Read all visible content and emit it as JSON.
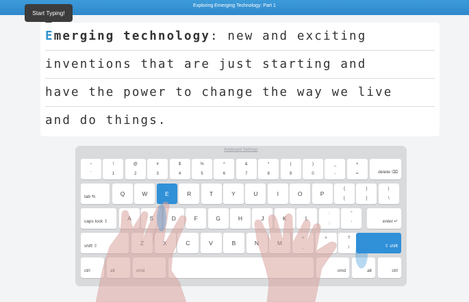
{
  "header": {
    "title": "Exploring Emerging Technology: Part 1"
  },
  "tooltip": {
    "text": "Start Typing!"
  },
  "passage": {
    "line1": {
      "cursor_letter": "E",
      "bold_rest": "merging technology",
      "rest": ": new and exciting"
    },
    "line2": "inventions that are just starting and",
    "line3": "have the power to change the way we live",
    "line4": "and do things."
  },
  "keyboard": {
    "settings_label": "Keyboard Settings",
    "row1": [
      {
        "top": "~",
        "bottom": "`"
      },
      {
        "top": "!",
        "bottom": "1"
      },
      {
        "top": "@",
        "bottom": "2"
      },
      {
        "top": "#",
        "bottom": "3"
      },
      {
        "top": "$",
        "bottom": "4"
      },
      {
        "top": "%",
        "bottom": "5"
      },
      {
        "top": "^",
        "bottom": "6"
      },
      {
        "top": "&",
        "bottom": "7"
      },
      {
        "top": "*",
        "bottom": "8"
      },
      {
        "top": "(",
        "bottom": "9"
      },
      {
        "top": ")",
        "bottom": "0"
      },
      {
        "top": "_",
        "bottom": "-"
      },
      {
        "top": "+",
        "bottom": "="
      }
    ],
    "delete_label": "delete ⌫",
    "tab_label": "tab ⇆",
    "row2_letters": [
      "Q",
      "W",
      "E",
      "R",
      "T",
      "Y",
      "U",
      "I",
      "O",
      "P"
    ],
    "row2_symbols": [
      {
        "top": "{",
        "bottom": "["
      },
      {
        "top": "}",
        "bottom": "]"
      },
      {
        "top": "|",
        "bottom": "\\"
      }
    ],
    "caps_label": "caps lock ⇪",
    "row3_letters": [
      "A",
      "S",
      "D",
      "F",
      "G",
      "H",
      "J",
      "K",
      "L"
    ],
    "row3_symbols": [
      {
        "top": ":",
        "bottom": ";"
      },
      {
        "top": "\"",
        "bottom": "'"
      }
    ],
    "enter_label": "enter ↵",
    "shift_left_label": "shift ⇧",
    "row4_letters": [
      "Z",
      "X",
      "C",
      "V",
      "B",
      "N",
      "M"
    ],
    "row4_symbols": [
      {
        "top": "<",
        "bottom": ","
      },
      {
        "top": ">",
        "bottom": "."
      },
      {
        "top": "?",
        "bottom": "/"
      }
    ],
    "shift_right_label": "⇧ shift",
    "bottom_row": {
      "ctrl": "ctrl",
      "alt": "alt",
      "cmd": "cmd",
      "space": "",
      "cmd_r": "cmd",
      "alt_r": "alt",
      "ctrl_r": "ctrl"
    },
    "active_keys": [
      "E",
      "shift-right"
    ],
    "colors": {
      "active": "#3090d8",
      "accent": "#2e93d1"
    }
  }
}
